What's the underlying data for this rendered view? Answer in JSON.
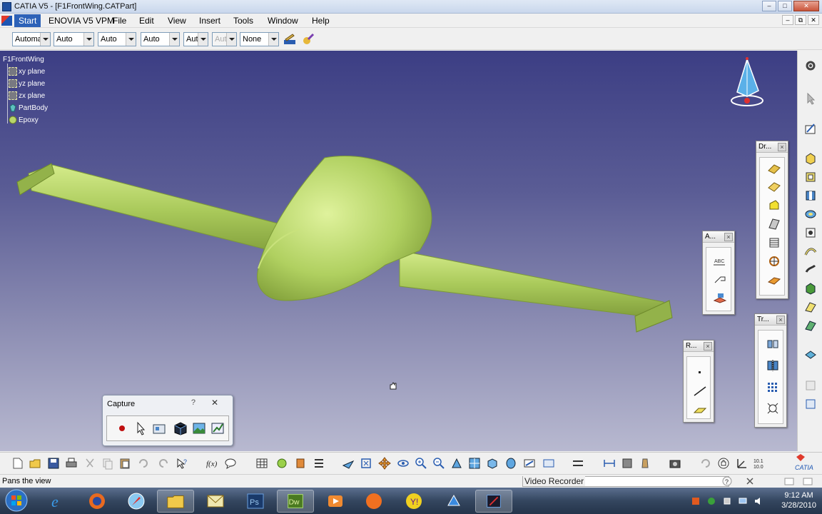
{
  "window": {
    "title": "CATIA V5 - [F1FrontWing.CATPart]",
    "min": "–",
    "max": "□",
    "close": "✕"
  },
  "doc_controls": {
    "min": "–",
    "restore": "⧉",
    "close": "✕"
  },
  "menu": {
    "start": "Start",
    "items": [
      "ENOVIA V5 VPM",
      "File",
      "Edit",
      "View",
      "Insert",
      "Tools",
      "Window",
      "Help"
    ]
  },
  "style_toolbar": {
    "combos": [
      "Automa",
      "Auto",
      "Auto",
      "Auto",
      "Aut",
      "Aut",
      "None"
    ]
  },
  "tree": {
    "root": "F1FrontWing",
    "children": [
      "xy plane",
      "yz plane",
      "zx plane",
      "PartBody",
      "Epoxy"
    ]
  },
  "float_toolbars": {
    "drafts": "Dr...",
    "annotations": "A...",
    "reference": "R...",
    "transform": "Tr..."
  },
  "capture": {
    "title": "Capture",
    "help": "?",
    "close": "✕"
  },
  "status": {
    "text": "Pans the view",
    "video_recorder": "Video Recorder"
  },
  "taskbar": {
    "time": "9:12 AM",
    "date": "3/28/2010"
  },
  "colors": {
    "part": "#b8d66a",
    "viewport_top": "#3c3e84",
    "viewport_bottom": "#b8b9d0"
  }
}
